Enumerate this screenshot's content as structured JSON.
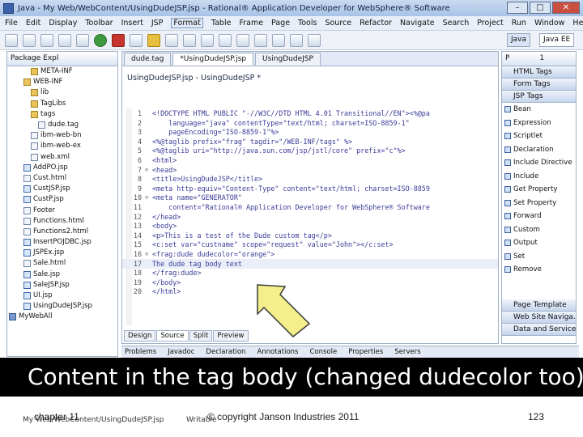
{
  "window": {
    "title": "Java - My Web/WebContent/UsingDudeJSP.jsp - Rational® Application Developer for WebSphere® Software",
    "buttons": [
      "–",
      "□",
      "✕"
    ]
  },
  "menubar": [
    "File",
    "Edit",
    "Display",
    "Toolbar",
    "Insert",
    "JSP",
    "Format",
    "Table",
    "Frame",
    "Page",
    "Tools",
    "Source",
    "Refactor",
    "Navigate",
    "Search",
    "Project",
    "Run",
    "Window",
    "Help"
  ],
  "menubar_active": "Format",
  "perspectives": [
    "Java",
    "Java EE"
  ],
  "explorer": {
    "tab": "Package Expl",
    "items": [
      {
        "label": "META-INF",
        "kind": "folder",
        "indent": 3
      },
      {
        "label": "WEB-INF",
        "kind": "folder",
        "indent": 2
      },
      {
        "label": "lib",
        "kind": "folder",
        "indent": 3
      },
      {
        "label": "TagLibs",
        "kind": "folder",
        "indent": 3
      },
      {
        "label": "tags",
        "kind": "folder",
        "indent": 3
      },
      {
        "label": "dude.tag",
        "kind": "file",
        "indent": 4
      },
      {
        "label": "ibm-web-bn",
        "kind": "file",
        "indent": 3
      },
      {
        "label": "ibm-web-ex",
        "kind": "file",
        "indent": 3
      },
      {
        "label": "web.xml",
        "kind": "file",
        "indent": 3
      },
      {
        "label": "AddPO.jsp",
        "kind": "jsp",
        "indent": 2
      },
      {
        "label": "Cust.html",
        "kind": "file",
        "indent": 2
      },
      {
        "label": "CustJSP.jsp",
        "kind": "jsp",
        "indent": 2
      },
      {
        "label": "CustP.jsp",
        "kind": "jsp",
        "indent": 2
      },
      {
        "label": "Footer",
        "kind": "file",
        "indent": 2
      },
      {
        "label": "Functions.html",
        "kind": "file",
        "indent": 2
      },
      {
        "label": "Functions2.html",
        "kind": "file",
        "indent": 2
      },
      {
        "label": "InsertPOJDBC.jsp",
        "kind": "jsp",
        "indent": 2
      },
      {
        "label": "JSPEx.jsp",
        "kind": "jsp",
        "indent": 2
      },
      {
        "label": "Sale.html",
        "kind": "file",
        "indent": 2
      },
      {
        "label": "Sale.jsp",
        "kind": "jsp",
        "indent": 2
      },
      {
        "label": "SaleJSP.jsp",
        "kind": "jsp",
        "indent": 2
      },
      {
        "label": "UI.jsp",
        "kind": "jsp",
        "indent": 2
      },
      {
        "label": "UsingDudeJSP.jsp",
        "kind": "jsp",
        "indent": 2
      },
      {
        "label": "MyWebAll",
        "kind": "project",
        "indent": 0
      }
    ]
  },
  "editor": {
    "tabs": [
      "dude.tag",
      "*UsingDudeJSP.jsp",
      "UsingDudeJSP"
    ],
    "active_tab": 1,
    "header": "UsingDudeJSP.jsp - UsingDudeJSP *",
    "lines": [
      {
        "n": "1",
        "text": "<!DOCTYPE HTML PUBLIC \"-//W3C//DTD HTML 4.01 Transitional//EN\"><%@pa"
      },
      {
        "n": "2",
        "text": "    language=\"java\" contentType=\"text/html; charset=ISO-8859-1\""
      },
      {
        "n": "3",
        "text": "    pageEncoding=\"ISO-8859-1\"%>"
      },
      {
        "n": "4",
        "text": "<%@taglib prefix=\"frag\" tagdir=\"/WEB-INF/tags\" %>"
      },
      {
        "n": "5",
        "text": "<%@taglib uri=\"http://java.sun.com/jsp/jstl/core\" prefix=\"c\"%>"
      },
      {
        "n": "6",
        "text": "<html>"
      },
      {
        "n": "7",
        "text": "<head>",
        "fold": "⊖"
      },
      {
        "n": "8",
        "text": "<title>UsingDudeJSP</title>"
      },
      {
        "n": "9",
        "text": "<meta http-equiv=\"Content-Type\" content=\"text/html; charset=ISO-8859"
      },
      {
        "n": "10",
        "text": "<meta name=\"GENERATOR\"",
        "fold": "⊖"
      },
      {
        "n": "11",
        "text": "    content=\"Rational® Application Developer for WebSphere® Software"
      },
      {
        "n": "12",
        "text": "</head>"
      },
      {
        "n": "13",
        "text": "<body>"
      },
      {
        "n": "14",
        "text": "<p>This is a test of the Dude custom tag</p>"
      },
      {
        "n": "15",
        "text": "<c:set var=\"custname\" scope=\"request\" value=\"John\"></c:set>"
      },
      {
        "n": "16",
        "text": "<frag:dude dudecolor=\"orange\">",
        "fold": "⊖"
      },
      {
        "n": "17",
        "text": "The dude tag body text",
        "current": true
      },
      {
        "n": "18",
        "text": "</frag:dude>"
      },
      {
        "n": "19",
        "text": "</body>"
      },
      {
        "n": "20",
        "text": "</html>"
      }
    ],
    "bottom_tabs": [
      "Design",
      "Source",
      "Split",
      "Preview"
    ],
    "active_bottom_tab": 1
  },
  "palette": {
    "tab": "P",
    "overflow": "1",
    "drawers": [
      "HTML Tags",
      "Form Tags",
      "JSP Tags"
    ],
    "items": [
      "Bean",
      "Expression",
      "Scriptlet",
      "Declaration",
      "Include Directive",
      "Include",
      "Get Property",
      "Set Property",
      "Forward",
      "Custom",
      "Output",
      "Set",
      "Remove"
    ],
    "bottom_drawers": [
      "Page Template",
      "Web Site Naviga...",
      "Data and Services"
    ]
  },
  "bottom_views": [
    "Problems",
    "Javadoc",
    "Declaration",
    "Annotations",
    "Console",
    "Properties",
    "Servers"
  ],
  "caption": "Content in the tag body (changed dudecolor too)",
  "status": {
    "path": "My Web/WebContent/UsingDudeJSP.jsp",
    "mode": "Writable"
  },
  "footer": {
    "chapter": "chapter 11",
    "copyright": "© copyright Janson Industries 2011",
    "page": "123"
  },
  "colors": {
    "caption_bg": "#000000",
    "caption_fg": "#ffffff",
    "arrow_fill": "#f4ef8a",
    "arrow_stroke": "#3a3a3a",
    "code_text": "#3b3b9a"
  },
  "icons": [
    "app-icon",
    "folder-icon",
    "file-icon",
    "jsp-icon",
    "project-icon",
    "palette-item-icon",
    "callout-arrow-icon"
  ]
}
